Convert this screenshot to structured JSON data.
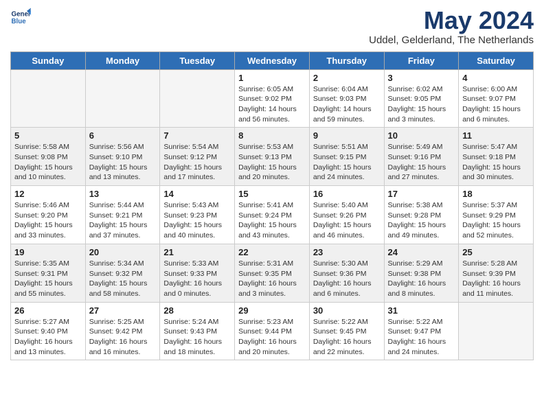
{
  "header": {
    "logo_line1": "General",
    "logo_line2": "Blue",
    "month_title": "May 2024",
    "location": "Uddel, Gelderland, The Netherlands"
  },
  "weekdays": [
    "Sunday",
    "Monday",
    "Tuesday",
    "Wednesday",
    "Thursday",
    "Friday",
    "Saturday"
  ],
  "weeks": [
    [
      {
        "day": "",
        "info": ""
      },
      {
        "day": "",
        "info": ""
      },
      {
        "day": "",
        "info": ""
      },
      {
        "day": "1",
        "info": "Sunrise: 6:05 AM\nSunset: 9:02 PM\nDaylight: 14 hours\nand 56 minutes."
      },
      {
        "day": "2",
        "info": "Sunrise: 6:04 AM\nSunset: 9:03 PM\nDaylight: 14 hours\nand 59 minutes."
      },
      {
        "day": "3",
        "info": "Sunrise: 6:02 AM\nSunset: 9:05 PM\nDaylight: 15 hours\nand 3 minutes."
      },
      {
        "day": "4",
        "info": "Sunrise: 6:00 AM\nSunset: 9:07 PM\nDaylight: 15 hours\nand 6 minutes."
      }
    ],
    [
      {
        "day": "5",
        "info": "Sunrise: 5:58 AM\nSunset: 9:08 PM\nDaylight: 15 hours\nand 10 minutes."
      },
      {
        "day": "6",
        "info": "Sunrise: 5:56 AM\nSunset: 9:10 PM\nDaylight: 15 hours\nand 13 minutes."
      },
      {
        "day": "7",
        "info": "Sunrise: 5:54 AM\nSunset: 9:12 PM\nDaylight: 15 hours\nand 17 minutes."
      },
      {
        "day": "8",
        "info": "Sunrise: 5:53 AM\nSunset: 9:13 PM\nDaylight: 15 hours\nand 20 minutes."
      },
      {
        "day": "9",
        "info": "Sunrise: 5:51 AM\nSunset: 9:15 PM\nDaylight: 15 hours\nand 24 minutes."
      },
      {
        "day": "10",
        "info": "Sunrise: 5:49 AM\nSunset: 9:16 PM\nDaylight: 15 hours\nand 27 minutes."
      },
      {
        "day": "11",
        "info": "Sunrise: 5:47 AM\nSunset: 9:18 PM\nDaylight: 15 hours\nand 30 minutes."
      }
    ],
    [
      {
        "day": "12",
        "info": "Sunrise: 5:46 AM\nSunset: 9:20 PM\nDaylight: 15 hours\nand 33 minutes."
      },
      {
        "day": "13",
        "info": "Sunrise: 5:44 AM\nSunset: 9:21 PM\nDaylight: 15 hours\nand 37 minutes."
      },
      {
        "day": "14",
        "info": "Sunrise: 5:43 AM\nSunset: 9:23 PM\nDaylight: 15 hours\nand 40 minutes."
      },
      {
        "day": "15",
        "info": "Sunrise: 5:41 AM\nSunset: 9:24 PM\nDaylight: 15 hours\nand 43 minutes."
      },
      {
        "day": "16",
        "info": "Sunrise: 5:40 AM\nSunset: 9:26 PM\nDaylight: 15 hours\nand 46 minutes."
      },
      {
        "day": "17",
        "info": "Sunrise: 5:38 AM\nSunset: 9:28 PM\nDaylight: 15 hours\nand 49 minutes."
      },
      {
        "day": "18",
        "info": "Sunrise: 5:37 AM\nSunset: 9:29 PM\nDaylight: 15 hours\nand 52 minutes."
      }
    ],
    [
      {
        "day": "19",
        "info": "Sunrise: 5:35 AM\nSunset: 9:31 PM\nDaylight: 15 hours\nand 55 minutes."
      },
      {
        "day": "20",
        "info": "Sunrise: 5:34 AM\nSunset: 9:32 PM\nDaylight: 15 hours\nand 58 minutes."
      },
      {
        "day": "21",
        "info": "Sunrise: 5:33 AM\nSunset: 9:33 PM\nDaylight: 16 hours\nand 0 minutes."
      },
      {
        "day": "22",
        "info": "Sunrise: 5:31 AM\nSunset: 9:35 PM\nDaylight: 16 hours\nand 3 minutes."
      },
      {
        "day": "23",
        "info": "Sunrise: 5:30 AM\nSunset: 9:36 PM\nDaylight: 16 hours\nand 6 minutes."
      },
      {
        "day": "24",
        "info": "Sunrise: 5:29 AM\nSunset: 9:38 PM\nDaylight: 16 hours\nand 8 minutes."
      },
      {
        "day": "25",
        "info": "Sunrise: 5:28 AM\nSunset: 9:39 PM\nDaylight: 16 hours\nand 11 minutes."
      }
    ],
    [
      {
        "day": "26",
        "info": "Sunrise: 5:27 AM\nSunset: 9:40 PM\nDaylight: 16 hours\nand 13 minutes."
      },
      {
        "day": "27",
        "info": "Sunrise: 5:25 AM\nSunset: 9:42 PM\nDaylight: 16 hours\nand 16 minutes."
      },
      {
        "day": "28",
        "info": "Sunrise: 5:24 AM\nSunset: 9:43 PM\nDaylight: 16 hours\nand 18 minutes."
      },
      {
        "day": "29",
        "info": "Sunrise: 5:23 AM\nSunset: 9:44 PM\nDaylight: 16 hours\nand 20 minutes."
      },
      {
        "day": "30",
        "info": "Sunrise: 5:22 AM\nSunset: 9:45 PM\nDaylight: 16 hours\nand 22 minutes."
      },
      {
        "day": "31",
        "info": "Sunrise: 5:22 AM\nSunset: 9:47 PM\nDaylight: 16 hours\nand 24 minutes."
      },
      {
        "day": "",
        "info": ""
      }
    ]
  ]
}
